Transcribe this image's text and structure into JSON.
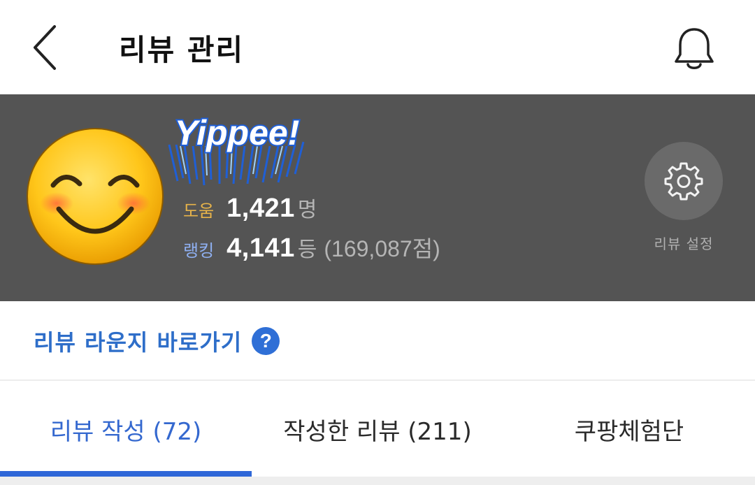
{
  "header": {
    "title": "리뷰 관리",
    "back_icon": "chevron-left-icon",
    "bell_icon": "bell-icon"
  },
  "profile": {
    "avatar_icon": "smiling-face-emoji",
    "sticker_text": "Yippee!",
    "help": {
      "label": "도움",
      "value": "1,421",
      "unit": "명"
    },
    "rank": {
      "label": "랭킹",
      "value": "4,141",
      "unit": "등",
      "extra": "(169,087점)"
    },
    "settings": {
      "icon": "gear-icon",
      "label": "리뷰 설정"
    }
  },
  "lounge": {
    "link_text": "리뷰 라운지 바로가기",
    "help_icon": "?"
  },
  "tabs": [
    {
      "label": "리뷰 작성 (72)",
      "active": true
    },
    {
      "label": "작성한 리뷰 (211)",
      "active": false
    },
    {
      "label": "쿠팡체험단",
      "active": false
    }
  ],
  "colors": {
    "accent": "#2f67d8",
    "profile_bg": "#545454",
    "help_label": "#e8b44a",
    "rank_label": "#8fb0f2"
  }
}
